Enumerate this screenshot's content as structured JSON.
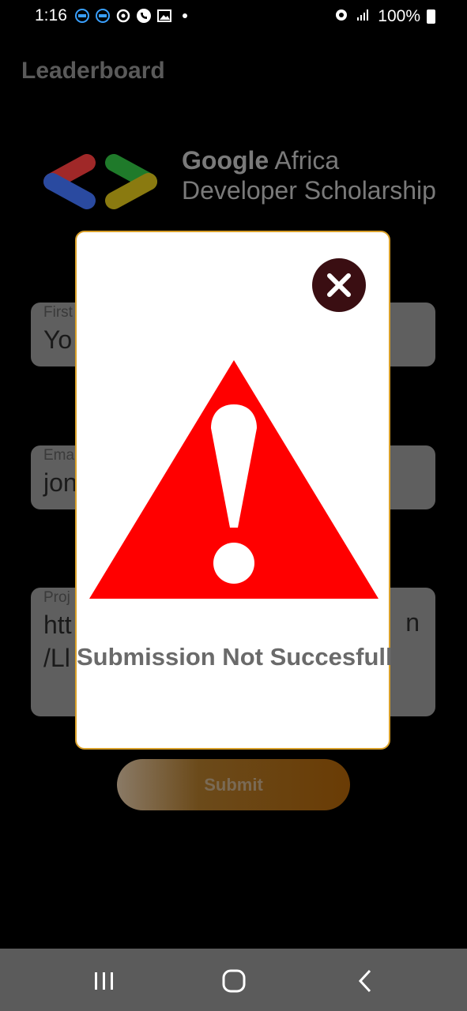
{
  "status_bar": {
    "time": "1:16",
    "battery": "100%",
    "notification_icons": [
      "email-icon",
      "email-icon",
      "sync-icon",
      "phone-icon",
      "image-icon",
      "dot-icon"
    ],
    "right_icons": [
      "alarm-icon",
      "signal-icon",
      "battery-icon"
    ]
  },
  "appbar": {
    "title": "Leaderboard"
  },
  "banner": {
    "line1_bold": "Google",
    "line1_rest": " Africa",
    "line2": "Developer Scholarship"
  },
  "form": {
    "first_name": {
      "label": "First",
      "value": "Yo"
    },
    "email": {
      "label": "Ema",
      "value": "jon"
    },
    "project": {
      "label": "Proj",
      "value_line1": "htt",
      "value_line2": "/Ll",
      "value_right": "n"
    },
    "submit_label": "Submit"
  },
  "modal": {
    "message": "Submission Not Succesfull",
    "close_icon": "close-icon",
    "warning_icon": "warning-icon",
    "colors": {
      "warning": "#ff0000",
      "close_bg": "#3a0e12",
      "border": "#d9a02a"
    }
  },
  "navbar": {
    "icons": [
      "recent-apps-icon",
      "home-icon",
      "back-icon"
    ]
  }
}
